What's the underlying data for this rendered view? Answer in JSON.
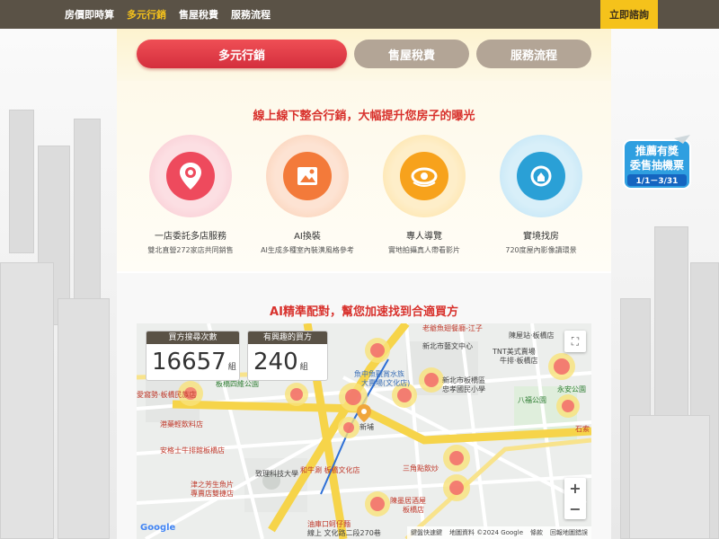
{
  "nav": {
    "links": [
      "房價即時算",
      "多元行銷",
      "售屋稅費",
      "服務流程"
    ],
    "active_index": 1,
    "cta": "立即諮詢"
  },
  "tabs": [
    "多元行銷",
    "售屋稅費",
    "服務流程"
  ],
  "section1": {
    "title": "線上線下整合行銷，大幅提升您房子的曝光",
    "features": [
      {
        "title": "一店委託多店服務",
        "desc": "雙北直營272家店共同銷售",
        "icon": "location-pin-icon"
      },
      {
        "title": "AI換裝",
        "desc": "AI生成多種室內裝潢風格參考",
        "icon": "ai-magic-image-icon"
      },
      {
        "title": "專人導覽",
        "desc": "實地拍攝真人帶看影片",
        "icon": "eye-rotate-icon"
      },
      {
        "title": "實境找房",
        "desc": "720度屋內影像讀環景",
        "icon": "vr-360-icon"
      }
    ]
  },
  "section2": {
    "title": "AI精準配對，幫您加速找到合適買方",
    "stats": [
      {
        "header": "買方搜尋次數",
        "value": "16657",
        "unit": "組"
      },
      {
        "header": "有興趣的買方",
        "value": "240",
        "unit": "組"
      }
    ]
  },
  "map": {
    "labels": [
      {
        "text": "老爺魚翅餐廳-江子",
        "color": "#c0392b"
      },
      {
        "text": "新北市藝文中心",
        "color": "#444"
      },
      {
        "text": "TNT美式賣場",
        "color": "#444"
      },
      {
        "text": "牛排·板橋店",
        "color": "#444"
      },
      {
        "text": "愛窩勢·板橋民族店",
        "color": "#c0392b"
      },
      {
        "text": "板橋四維公園",
        "color": "#2e7d32"
      },
      {
        "text": "魚中魚觀賞水族",
        "color": "#3b6fb6"
      },
      {
        "text": "大賣場(文化店)",
        "color": "#3b6fb6"
      },
      {
        "text": "新北市板橋區",
        "color": "#444"
      },
      {
        "text": "忠孝國民小學",
        "color": "#444"
      },
      {
        "text": "八福公園",
        "color": "#2e7d32"
      },
      {
        "text": "永安公園",
        "color": "#2e7d32"
      },
      {
        "text": "港藥輕飲料店",
        "color": "#c0392b"
      },
      {
        "text": "安格士牛排館板橋店",
        "color": "#c0392b"
      },
      {
        "text": "津之芳生魚片",
        "color": "#c0392b"
      },
      {
        "text": "專賣店雙捷店",
        "color": "#c0392b"
      },
      {
        "text": "致理科技大學",
        "color": "#444"
      },
      {
        "text": "和牛涮 板橋文化店",
        "color": "#c0392b"
      },
      {
        "text": "三角點飲炒",
        "color": "#c0392b"
      },
      {
        "text": "陳墨居酒屋",
        "color": "#c0392b"
      },
      {
        "text": "板橋店",
        "color": "#c0392b"
      },
      {
        "text": "油庫口蚵仔麵",
        "color": "#c0392b"
      },
      {
        "text": "線上 文化路二段270巷",
        "color": "#444"
      },
      {
        "text": "新埔",
        "color": "#444"
      },
      {
        "text": "石索",
        "color": "#c0392b"
      },
      {
        "text": "陳屋站·板橋店",
        "color": "#444"
      }
    ],
    "google_logo": "Google",
    "attribution": [
      "鍵盤快速鍵",
      "地圖資料 ©2024 Google",
      "條款",
      "回報地圖錯誤"
    ],
    "zoom_in": "+",
    "zoom_out": "−"
  },
  "promo": {
    "line1": "推薦有獎",
    "line2": "委售抽機票",
    "dates": "1/1－3/31"
  },
  "colors": {
    "nav_bg": "#5a5246",
    "accent_yellow": "#f5c21b",
    "primary_red": "#d8322d",
    "tab_inactive": "#b3a596"
  }
}
